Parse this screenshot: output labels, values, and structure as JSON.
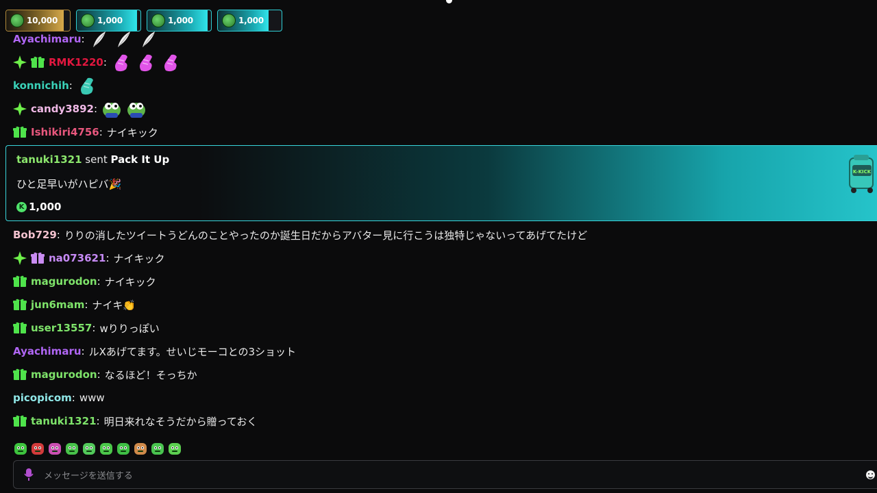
{
  "pinned_gifts": [
    {
      "amount": "10,000",
      "tier": "gold",
      "fill": 0.9
    },
    {
      "amount": "1,000",
      "tier": "teal",
      "fill": 0.95
    },
    {
      "amount": "1,000",
      "tier": "teal",
      "fill": 0.95
    },
    {
      "amount": "1,000",
      "tier": "teal",
      "fill": 0.8
    }
  ],
  "messages": [
    {
      "user": "Ayachimaru",
      "color": "#b066f5",
      "badges": [],
      "text": "",
      "emote_count": 3,
      "emote_name": "feather-emote",
      "emote_color": "#eeeeee"
    },
    {
      "user": "RMK1220",
      "color": "#e2173f",
      "badges": [
        "sparkle",
        "gift-green"
      ],
      "text": "",
      "emote_count": 3,
      "emote_name": "pink-shoe-emote",
      "emote_color": "#e154e8"
    },
    {
      "user": "konnichih",
      "color": "#3ad1b8",
      "badges": [],
      "text": "",
      "emote_count": 1,
      "emote_name": "teal-shoe-emote",
      "emote_color": "#39c8b3"
    },
    {
      "user": "candy3892",
      "color": "#f0b9e6",
      "badges": [
        "sparkle"
      ],
      "text": "",
      "emote_count": 2,
      "emote_name": "pepe-emote",
      "emote_color": "#5fb34a"
    },
    {
      "user": "Ishikiri4756",
      "color": "#e8577d",
      "badges": [
        "gift-green"
      ],
      "text": "ナイキック",
      "emote_count": 0
    },
    {
      "user": "Bob729",
      "color": "#f3c2cf",
      "badges": [],
      "text": "りりの消したツイートうどんのことやったのか誕生日だからアバター見に行こうは独特じゃないってあげてたけど",
      "emote_count": 0
    },
    {
      "user": "na073621",
      "color": "#c68af5",
      "badges": [
        "sparkle",
        "gift-purple"
      ],
      "text": "ナイキック",
      "emote_count": 0
    },
    {
      "user": "magurodon",
      "color": "#7ee36a",
      "badges": [
        "gift-green"
      ],
      "text": "ナイキック",
      "emote_count": 0
    },
    {
      "user": "jun6mam",
      "color": "#7ee36a",
      "badges": [
        "gift-green"
      ],
      "text": "ナイキ👏",
      "emote_count": 0
    },
    {
      "user": "user13557",
      "color": "#7ee36a",
      "badges": [
        "gift-green"
      ],
      "text": "wりりっぽい",
      "emote_count": 0
    },
    {
      "user": "Ayachimaru",
      "color": "#b066f5",
      "badges": [],
      "text": "ルXあげてます。せいじモーコとの3ショット",
      "emote_count": 0
    },
    {
      "user": "magurodon",
      "color": "#7ee36a",
      "badges": [
        "gift-green"
      ],
      "text": "なるほど！そっちか",
      "emote_count": 0
    },
    {
      "user": "picopicom",
      "color": "#8fe6e6",
      "badges": [],
      "text": "www",
      "emote_count": 0
    },
    {
      "user": "tanuki1321",
      "color": "#7ee36a",
      "badges": [
        "gift-green"
      ],
      "text": "明日来れなそうだから贈っておく",
      "emote_count": 0
    }
  ],
  "gift_card": {
    "user": "tanuki1321",
    "sent_word": "sent",
    "item": "Pack It Up",
    "message": "ひと足早いがハピバ🎉",
    "amount": "1,000",
    "coin_letter": "K",
    "bag_label": "K-KICK"
  },
  "quick_emotes": [
    {
      "name": "trophy-emote",
      "color": "#3ec43e"
    },
    {
      "name": "angry-emote",
      "color": "#d23b3b"
    },
    {
      "name": "skull-emote",
      "color": "#c94fb1"
    },
    {
      "name": "sleepy-emote",
      "color": "#48c24a"
    },
    {
      "name": "mushroom-emote",
      "color": "#52c95a"
    },
    {
      "name": "blob-emote",
      "color": "#4cc74a"
    },
    {
      "name": "ghost-emote",
      "color": "#3fbf45"
    },
    {
      "name": "burger-emote",
      "color": "#d08a4a"
    },
    {
      "name": "slime-emote",
      "color": "#49c34f"
    },
    {
      "name": "smirk-emote",
      "color": "#5ccf50"
    }
  ],
  "input": {
    "placeholder": "メッセージを送信する"
  }
}
